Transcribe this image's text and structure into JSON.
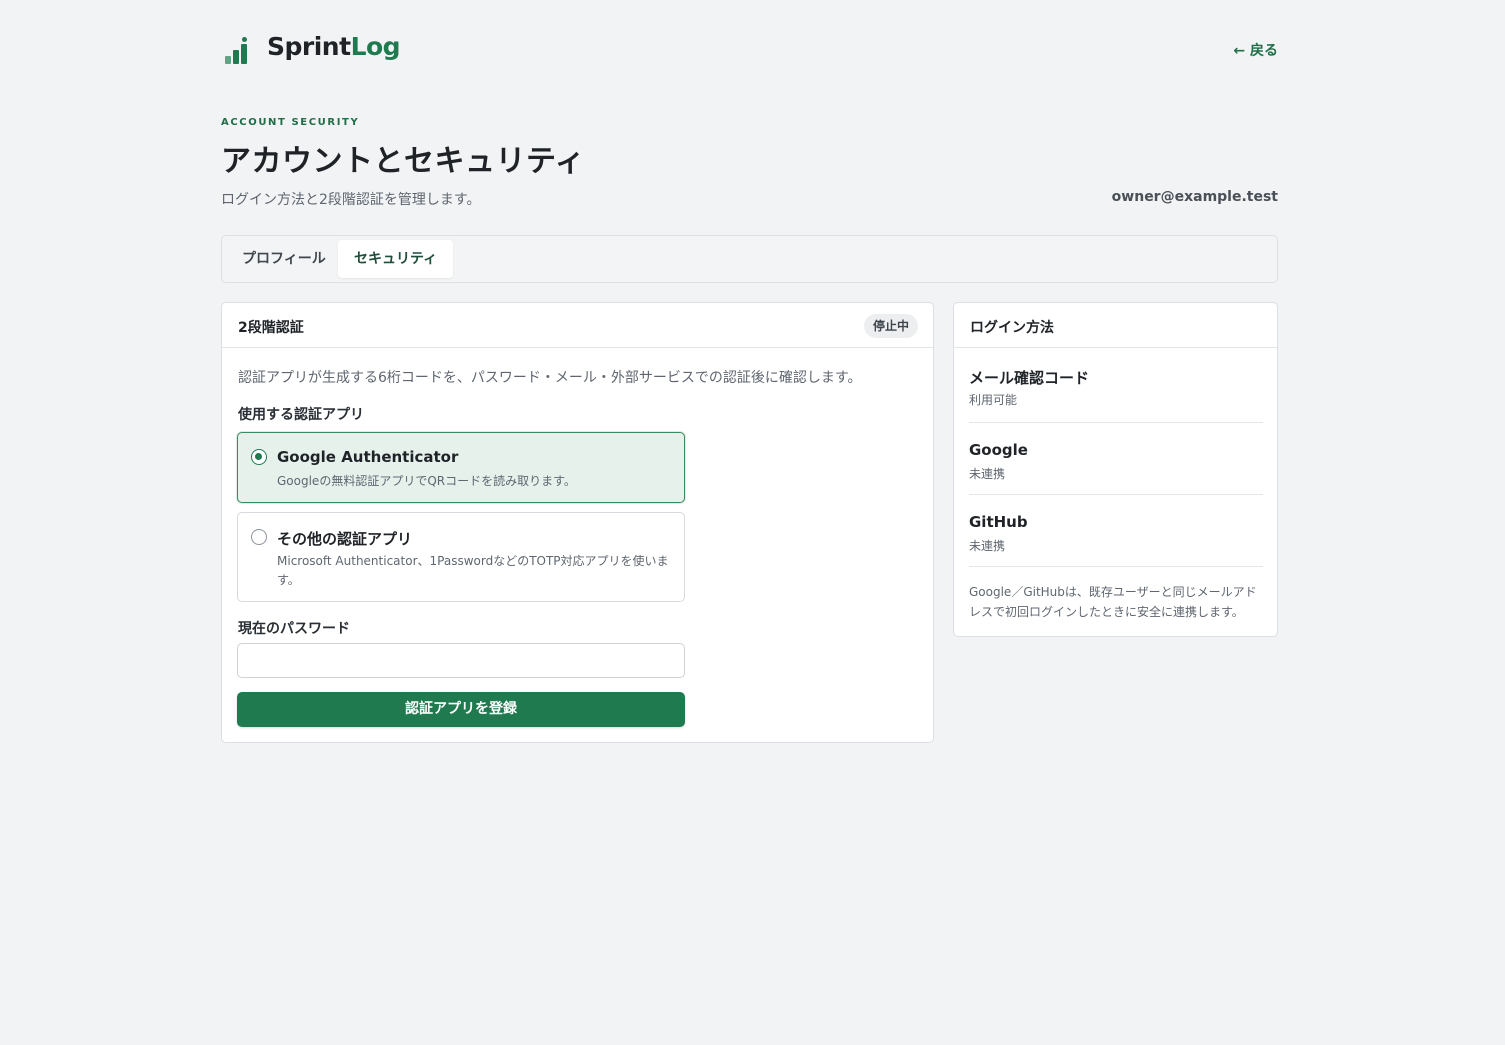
{
  "brand": {
    "name_part1": "Sprint",
    "name_part2": "Log",
    "accent_color": "#1f7a4f"
  },
  "header": {
    "back_label": "← 戻る"
  },
  "page": {
    "eyebrow": "ACCOUNT SECURITY",
    "title": "アカウントとセキュリティ",
    "subtitle": "ログイン方法と2段階認証を管理します。",
    "user_email": "owner@example.test"
  },
  "tabs": [
    {
      "label": "プロフィール",
      "active": false
    },
    {
      "label": "セキュリティ",
      "active": true
    }
  ],
  "two_factor": {
    "title": "2段階認証",
    "status": "停止中",
    "description": "認証アプリが生成する6桁コードを、パスワード・メール・外部サービスでの認証後に確認します。",
    "app_label": "使用する認証アプリ",
    "options": [
      {
        "title": "Google Authenticator",
        "description": "Googleの無料認証アプリでQRコードを読み取ります。",
        "selected": true
      },
      {
        "title": "その他の認証アプリ",
        "description": "Microsoft Authenticator、1PasswordなどのTOTP対応アプリを使います。",
        "selected": false
      }
    ],
    "password_label": "現在のパスワード",
    "password_value": "",
    "submit_label": "認証アプリを登録"
  },
  "login_methods": {
    "title": "ログイン方法",
    "items": [
      {
        "name": "メール確認コード",
        "status": "利用可能"
      },
      {
        "name": "Google",
        "status": "未連携"
      },
      {
        "name": "GitHub",
        "status": "未連携"
      }
    ],
    "note": "Google／GitHubは、既存ユーザーと同じメールアドレスで初回ログインしたときに安全に連携します。"
  }
}
